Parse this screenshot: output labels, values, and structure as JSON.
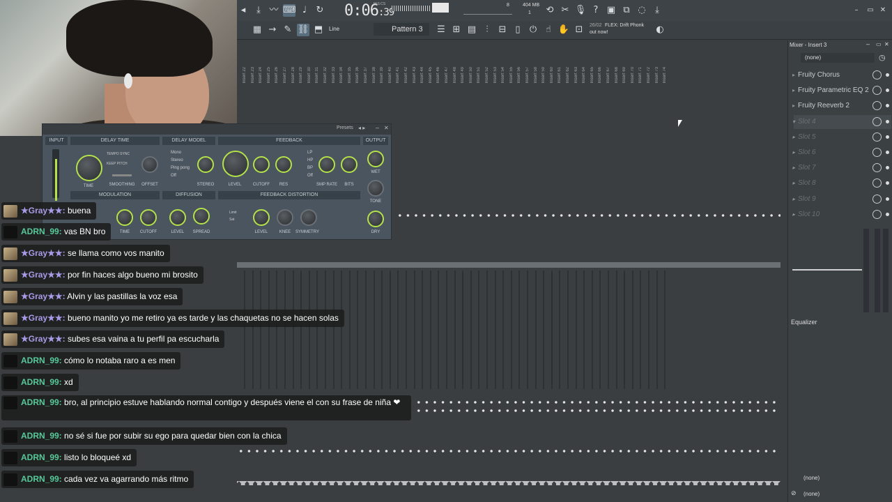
{
  "toolbar": {
    "time": "0:06",
    "time_sub": "39",
    "mics": "M:S:CS",
    "memory": "404 MB",
    "cpu": "8",
    "polyphony": "1",
    "pattern": "Pattern 3",
    "snap": "Line",
    "hint_date": "26/02",
    "hint_text": "FLEX: Drift Phonk",
    "hint_text2": "out now!"
  },
  "mixer_strips": [
    "Insert 22",
    "Insert 23",
    "Insert 24",
    "Insert 25",
    "Insert 26",
    "Insert 27",
    "Insert 28",
    "Insert 29",
    "Insert 30",
    "Insert 31",
    "Insert 32",
    "Insert 33",
    "Insert 34",
    "Insert 35",
    "Insert 36",
    "Insert 37",
    "Insert 38",
    "Insert 39",
    "Insert 40",
    "Insert 41",
    "Insert 42",
    "Insert 43",
    "Insert 44",
    "Insert 45",
    "Insert 46",
    "Insert 47",
    "Insert 48",
    "Insert 49",
    "Insert 50",
    "Insert 51",
    "Insert 52",
    "Insert 53",
    "Insert 54",
    "Insert 55",
    "Insert 56",
    "Insert 57",
    "Insert 58",
    "Insert 59",
    "Insert 60",
    "Insert 61",
    "Insert 62",
    "Insert 63",
    "Insert 64",
    "Insert 65",
    "Insert 66",
    "Insert 67",
    "Insert 68",
    "Insert 69",
    "Insert 70",
    "Insert 71",
    "Insert 72",
    "Insert 73",
    "Insert 74"
  ],
  "plugin": {
    "presets": "Presets",
    "sections": {
      "input": "INPUT",
      "delay_time": "DELAY TIME",
      "delay_model": "DELAY MODEL",
      "feedback": "FEEDBACK",
      "output": "OUTPUT",
      "modulation": "MODULATION",
      "diffusion": "DIFFUSION",
      "feedback_distortion": "FEEDBACK DISTORTION"
    },
    "options": {
      "tempo_sync": "TEMPO SYNC",
      "keep_pitch": "KEEP PITCH",
      "mono": "Mono",
      "stereo": "Stereo",
      "ping_pong": "Ping pong",
      "off": "Off",
      "lp": "LP",
      "hp": "HP",
      "bp": "BP",
      "off2": "Off",
      "limit": "Limit",
      "sat": "Sat"
    },
    "labels": {
      "time": "TIME",
      "smoothing": "SMOOTHING",
      "offset": "OFFSET",
      "stereo": "STEREO",
      "level": "LEVEL",
      "cutoff": "CUTOFF",
      "res": "RES",
      "smp_rate": "SMP RATE",
      "bits": "BITS",
      "wet": "WET",
      "tone": "TONE",
      "dry": "DRY",
      "mod_time": "TIME",
      "mod_cutoff": "CUTOFF",
      "diff_level": "LEVEL",
      "spread": "SPREAD",
      "dist_level": "LEVEL",
      "knee": "KNEE",
      "symmetry": "SYMMETRY"
    }
  },
  "chat": [
    {
      "user": "★Gray★★:",
      "text": "buena",
      "type": "gray"
    },
    {
      "user": "ADRN_99:",
      "text": "vas BN bro",
      "type": "adrn"
    },
    {
      "user": "★Gray★★:",
      "text": "se llama como vos manito",
      "type": "gray"
    },
    {
      "user": "★Gray★★:",
      "text": "por fin haces algo bueno mi brosito",
      "type": "gray"
    },
    {
      "user": "★Gray★★:",
      "text": "Alvin y las pastillas la voz esa",
      "type": "gray"
    },
    {
      "user": "★Gray★★:",
      "text": "bueno manito yo me retiro ya es tarde y las chaquetas no se hacen solas",
      "type": "gray"
    },
    {
      "user": "★Gray★★:",
      "text": "subes esa vaina a tu perfil pa escucharla",
      "type": "gray"
    },
    {
      "user": "ADRN_99:",
      "text": "cómo lo notaba raro a es men",
      "type": "adrn"
    },
    {
      "user": "ADRN_99:",
      "text": "xd",
      "type": "adrn"
    },
    {
      "user": "ADRN_99:",
      "text": "bro, al principio estuve hablando normal contigo y después viene el con su frase de niña ❤",
      "type": "adrn"
    },
    {
      "user": "ADRN_99:",
      "text": "no sé si fue por subir su ego para quedar bien con la chica",
      "type": "adrn"
    },
    {
      "user": "ADRN_99:",
      "text": "listo lo bloqueé xd",
      "type": "adrn"
    },
    {
      "user": "ADRN_99:",
      "text": "cada vez va agarrando más ritmo",
      "type": "adrn"
    }
  ],
  "right_panel": {
    "title": "Mixer - Insert 3",
    "input": "(none)",
    "slots": [
      "Fruity Chorus",
      "Fruity Parametric EQ 2",
      "Fruity Reeverb 2",
      "Slot 4",
      "Slot 5",
      "Slot 6",
      "Slot 7",
      "Slot 8",
      "Slot 9",
      "Slot 10"
    ],
    "equalizer": "Equalizer",
    "out1": "(none)",
    "out2": "(none)"
  },
  "colors": {
    "accent": "#b4e24a",
    "gray_user": "#a99be8",
    "adrn_user": "#57c99a"
  }
}
